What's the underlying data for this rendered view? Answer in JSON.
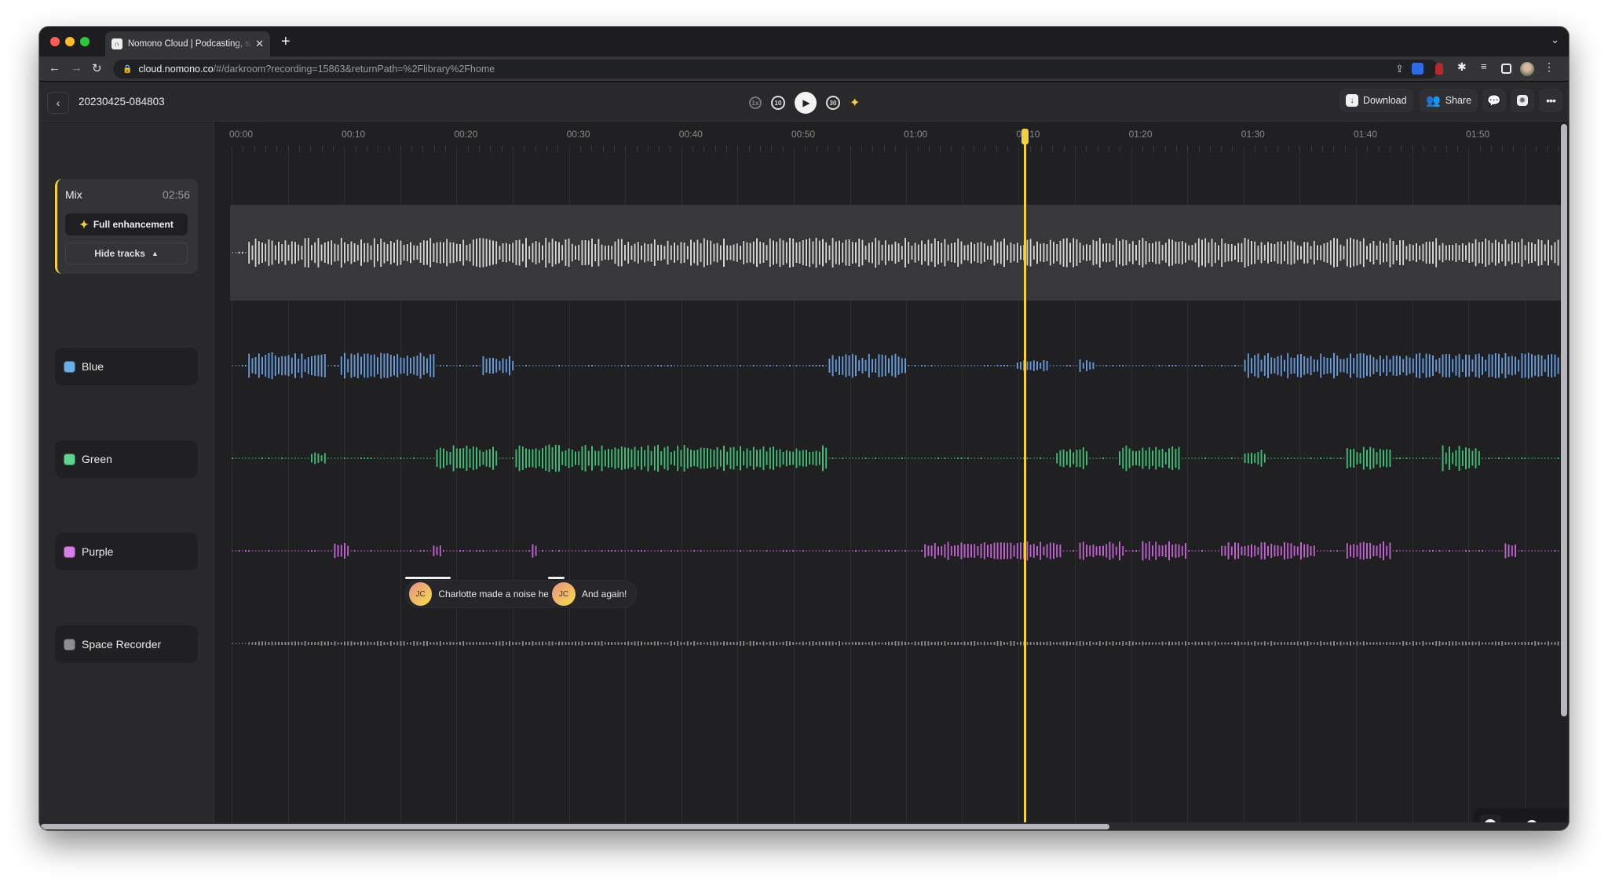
{
  "browser": {
    "tab_title": "Nomono Cloud | Podcasting, simplified",
    "tab_favicon": "nomono-logo-icon",
    "url_host": "cloud.nomono.co",
    "url_path": "/#/darkroom?recording=15863&returnPath=%2Flibrary%2Fhome",
    "traffic_colors": {
      "close": "#ff5f57",
      "minimize": "#febc2e",
      "maximize": "#28c840"
    }
  },
  "header": {
    "back_icon": "chevron-left-icon",
    "recording_title": "20230425-084803",
    "transport": {
      "speed_label": "1x",
      "skip_back_label": "10",
      "skip_forward_label": "30",
      "play_icon": "play-icon",
      "enhance_icon": "sparkle-icon"
    },
    "download_label": "Download",
    "share_label": "Share",
    "comments_icon": "chat-bubbles-icon",
    "settings_icon": "gear-badge-icon",
    "more_icon": "more-horizontal-icon"
  },
  "mix": {
    "title": "Mix",
    "duration": "02:56",
    "enhance_label": "Full enhancement",
    "hide_tracks_label": "Hide tracks",
    "accent": "#f2cf45"
  },
  "tracks": [
    {
      "name": "Blue",
      "color": "#6aaeea",
      "wave": "#6a9ad6"
    },
    {
      "name": "Green",
      "color": "#5fd48e",
      "wave": "#48b879"
    },
    {
      "name": "Purple",
      "color": "#d67fe6",
      "wave": "#b965c9"
    },
    {
      "name": "Space Recorder",
      "color": "#8e8e90",
      "wave": "#8a8a8c"
    }
  ],
  "ruler": {
    "labels": [
      "00:00",
      "00:10",
      "00:20",
      "00:30",
      "00:40",
      "00:50",
      "01:00",
      "01:10",
      "01:20",
      "01:30",
      "01:40",
      "01:50"
    ]
  },
  "playhead": {
    "time_seconds": 70.5,
    "color": "#f2cf45"
  },
  "comments": [
    {
      "initials": "JC",
      "text": "Charlotte made a noise here"
    },
    {
      "initials": "JC",
      "text": "And again!"
    }
  ],
  "zoom": {
    "level_fraction": 0.45
  },
  "scroll": {
    "horizontal_fraction": 0.7
  }
}
